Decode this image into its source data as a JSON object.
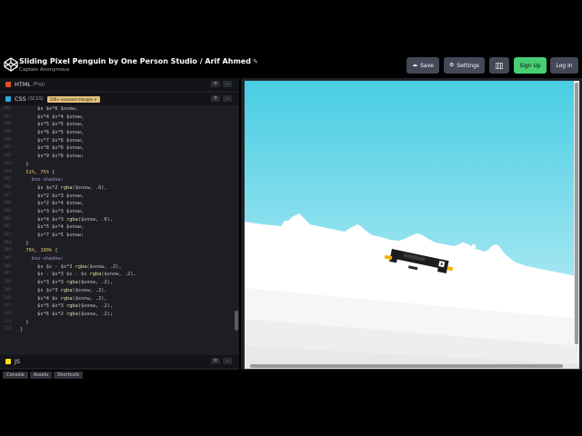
{
  "header": {
    "title": "Sliding Pixel Penguin by One Person Studio / Arif Ahmed",
    "edit_icon": "pencil-icon",
    "author": "Captain Anonymous",
    "buttons": {
      "save": "Save",
      "settings": "Settings",
      "signup": "Sign Up",
      "login": "Log In"
    }
  },
  "editors": {
    "html": {
      "name": "HTML",
      "sub": "(Pug)"
    },
    "css": {
      "name": "CSS",
      "sub": "(SCSS)",
      "badge": "100+ unsaved changes ✕"
    },
    "js": {
      "name": "JS",
      "sub": ""
    }
  },
  "code_lines": [
    {
      "n": "286",
      "t": "      $s $s*6 $snow,"
    },
    {
      "n": "287",
      "t": "      $s*4 $s*4 $snow,"
    },
    {
      "n": "288",
      "t": "      $s*5 $s*5 $snow,"
    },
    {
      "n": "289",
      "t": "      $s*6 $s*5 $snow,"
    },
    {
      "n": "290",
      "t": "      $s*7 $s*6 $snow,"
    },
    {
      "n": "291",
      "t": "      $s*8 $s*6 $snow,"
    },
    {
      "n": "292",
      "t": "      $s*9 $s*6 $snow;"
    },
    {
      "n": "293",
      "t": "  }"
    },
    {
      "n": "294",
      "t": "  51%, 75% {"
    },
    {
      "n": "295",
      "t": "    box-shadow:"
    },
    {
      "n": "296",
      "t": "      $s $s*2 rgba($snow, .6),"
    },
    {
      "n": "297",
      "t": "      $s*2 $s*3 $snow,"
    },
    {
      "n": "298",
      "t": "      $s*2 $s*4 $snow,"
    },
    {
      "n": "299",
      "t": "      $s*3 $s*3 $snow,"
    },
    {
      "n": "300",
      "t": "      $s*4 $s*3 rgba($snow, .6),"
    },
    {
      "n": "301",
      "t": "      $s*5 $s*4 $snow,"
    },
    {
      "n": "302",
      "t": "      $s*7 $s*5 $snow;"
    },
    {
      "n": "303",
      "t": "  }"
    },
    {
      "n": "304",
      "t": "  76%, 100% {"
    },
    {
      "n": "305",
      "t": "    box-shadow:"
    },
    {
      "n": "306",
      "t": "      $s $s - $s*3 rgba($snow, .2),"
    },
    {
      "n": "307",
      "t": "      $s - $s*3 $s - $s rgba($snow, .2),"
    },
    {
      "n": "308",
      "t": "      $s*3 $s*3 rgba($snow, .2),"
    },
    {
      "n": "309",
      "t": "      $s $s*3 rgba($snow, .2),"
    },
    {
      "n": "310",
      "t": "      $s*4 $s rgba($snow, .2),"
    },
    {
      "n": "311",
      "t": "      $s*5 $s*3 rgba($snow, .2),"
    },
    {
      "n": "312",
      "t": "      $s*6 $s*2 rgba($snow, .2);"
    },
    {
      "n": "313",
      "t": "  }"
    },
    {
      "n": "314",
      "t": "}"
    }
  ],
  "bottom": {
    "console": "Console",
    "assets": "Assets",
    "shortcuts": "Shortcuts"
  },
  "colors": {
    "sky_top": "#48cde3",
    "sky_bottom": "#c9f1f8",
    "snow": "#ffffff",
    "signup_green": "#47cf73"
  }
}
